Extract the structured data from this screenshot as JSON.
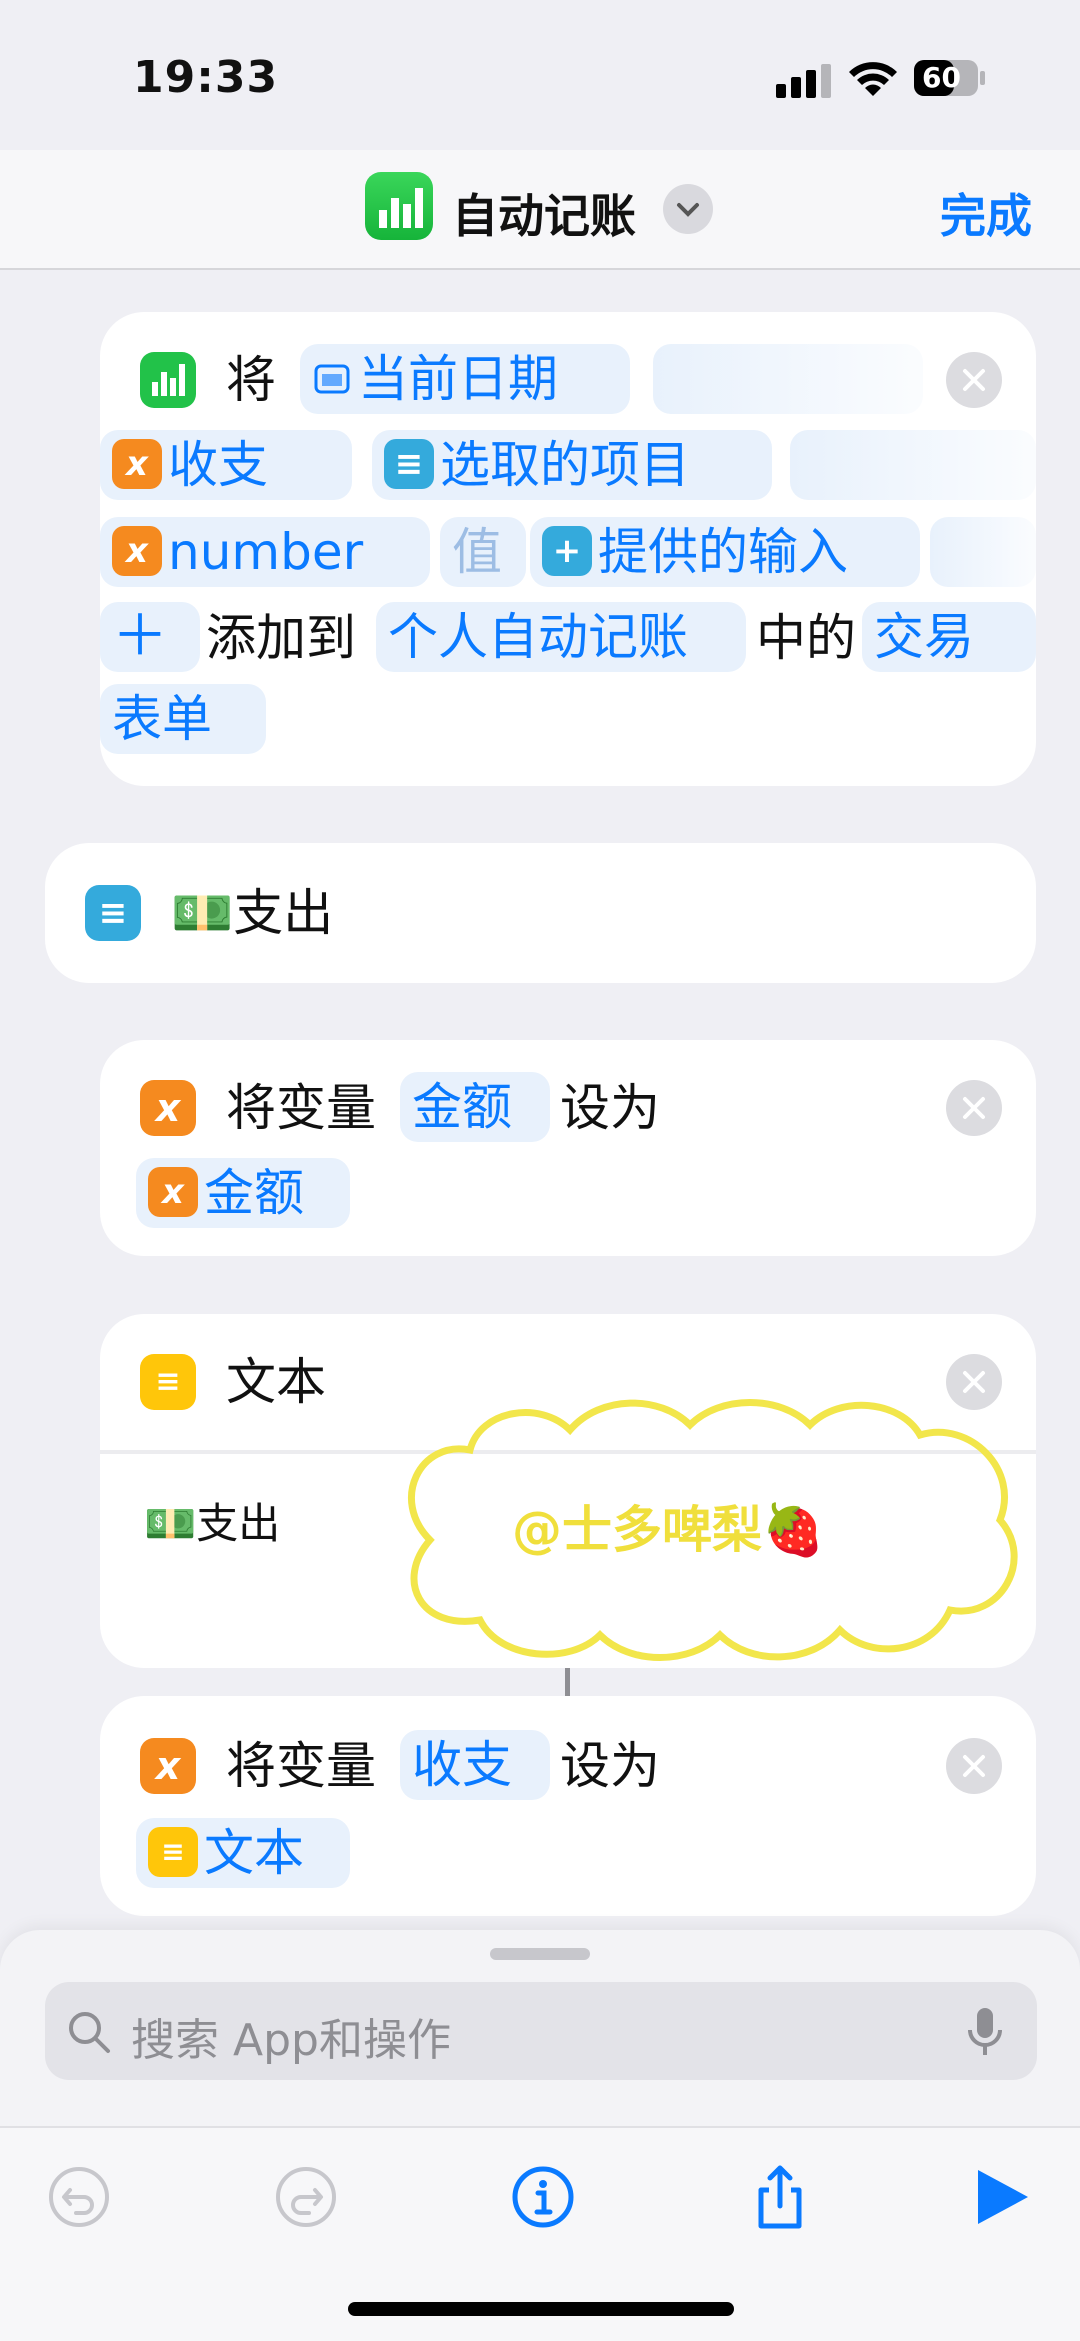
{
  "status": {
    "time": "19:33",
    "battery": "60"
  },
  "nav": {
    "title": "自动记账",
    "done": "完成"
  },
  "card1": {
    "verb": "将",
    "date_var": "当前日期",
    "field1": "收支",
    "value1": "选取的项目",
    "field2": "number",
    "value_label": "值",
    "value2": "提供的输入",
    "add_prefix": "添加到",
    "target": "个人自动记账",
    "middle": "中的",
    "sheet_a": "交易",
    "sheet_b": "表单"
  },
  "card2": {
    "label": "💵支出"
  },
  "card3": {
    "prefix": "将变量",
    "var_name": "金额",
    "suffix": "设为",
    "value": "金额"
  },
  "card4": {
    "title": "文本",
    "body": "💵支出",
    "watermark": "@士多啤梨🍓"
  },
  "card5": {
    "prefix": "将变量",
    "var_name": "收支",
    "suffix": "设为",
    "value": "文本"
  },
  "search": {
    "placeholder": "搜索 App和操作"
  },
  "colors": {
    "accent": "#0a7aff",
    "orange": "#f58a1f",
    "yellow": "#ffc60a",
    "green": "#22c249"
  }
}
